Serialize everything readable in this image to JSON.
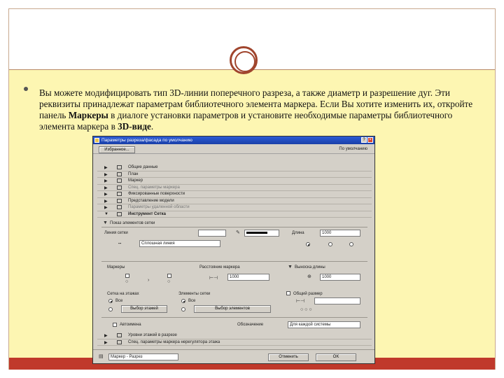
{
  "slide": {
    "paragraph_part1": "Вы можете модифицировать тип 3D-линии поперечного разреза, а также диаметр и разрешение дуг. Эти реквизиты принадлежат параметрам библиотечного элемента маркера. Если Вы хотите изменить их, откройте панель ",
    "bold_markers": "Маркеры",
    "paragraph_part2": " в диалоге установки параметров и установите необходимые параметры библиотечного элемента маркера в ",
    "bold_3d": "3D-виде",
    "paragraph_end": "."
  },
  "dialog": {
    "title": "Параметры разреза/фасада по умолчанию",
    "favorites_button": "Избранное...",
    "default_label": "По умолчанию",
    "sections": [
      {
        "label": "Общие данные",
        "dim": false
      },
      {
        "label": "План",
        "dim": false
      },
      {
        "label": "Маркер",
        "dim": false
      },
      {
        "label": "Спец. параметры маркера",
        "dim": true
      },
      {
        "label": "Фиксированные поверхности",
        "dim": false
      },
      {
        "label": "Представление модели",
        "dim": false
      },
      {
        "label": "Параметры удаленной области",
        "dim": true
      },
      {
        "label": "Инструмент Сетка",
        "dim": false
      }
    ],
    "grid_panel": {
      "show_label": "Показ элементов сетки",
      "line_type_label": "Линия сетки",
      "width_label": "Длина",
      "width_value": "1000",
      "pattern_label": "Сплошная линия",
      "markers_label": "Маркеры",
      "distance_label": "Расстояние маркера",
      "distance_value": "1000",
      "bubble_label": "Выноска длины",
      "bubble_value": "1000",
      "floors_label": "Сетка на этажах",
      "all_label": "Все",
      "select_floors_button": "Выбор этажей",
      "elements_label": "Элементы сетки",
      "all2_label": "Все",
      "select_elements_button": "Выбор элементов",
      "total_label": "Общий размер",
      "auto_label": "Автоимена",
      "numbering_label": "Обозначение",
      "numbering_value": "Для каждой системы"
    },
    "bottom_sections": [
      {
        "label": "Уровни этажей в разрезе",
        "dim": false
      },
      {
        "label": "Спец. параметры маркера нерегулятора этажа",
        "dim": false
      }
    ],
    "footer": {
      "layer_value": "Маркер - Разрез",
      "cancel_button": "Отменить",
      "ok_button": "OK"
    }
  }
}
